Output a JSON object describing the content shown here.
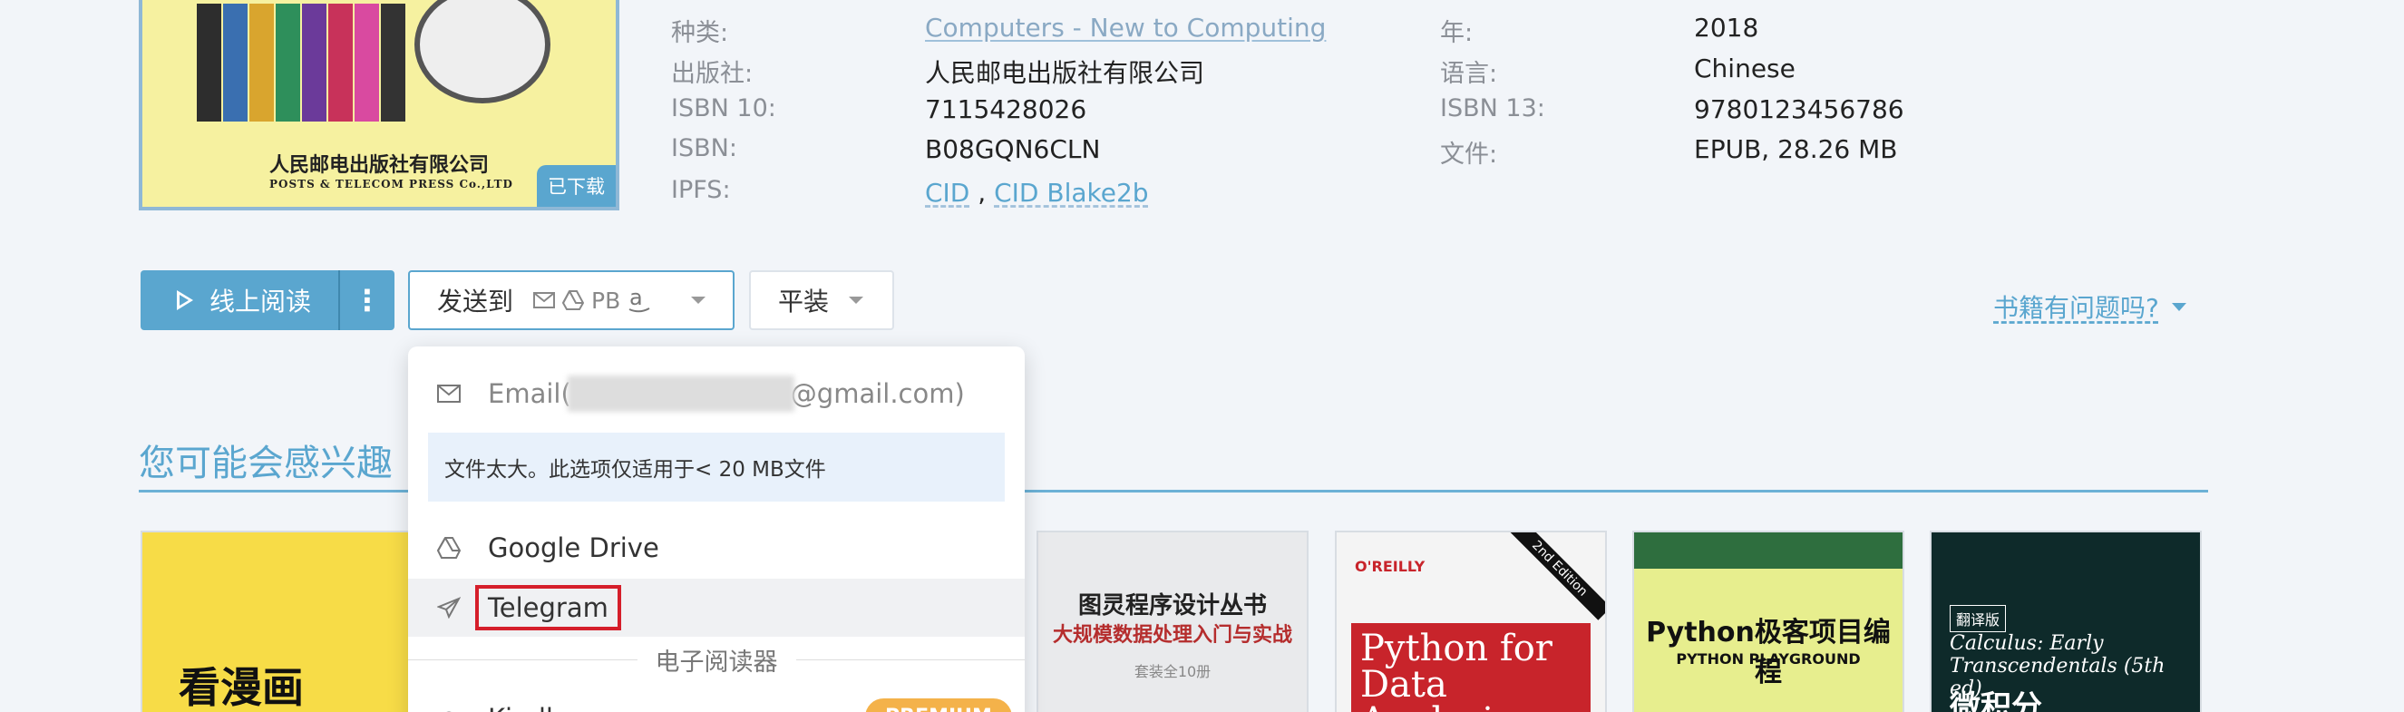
{
  "cover": {
    "publisher_cn": "人民邮电出版社有限公司",
    "publisher_en": "POSTS & TELECOM PRESS Co.,LTD",
    "badge": "已下载"
  },
  "meta": {
    "category_label": "种类:",
    "category_value": "Computers - New to Computing",
    "publisher_label": "出版社:",
    "publisher_value": "人民邮电出版社有限公司",
    "isbn10_label": "ISBN 10:",
    "isbn10_value": "7115428026",
    "isbn_label": "ISBN:",
    "isbn_value": "B08GQN6CLN",
    "ipfs_label": "IPFS:",
    "ipfs_cid": "CID",
    "ipfs_sep": ",",
    "ipfs_blake": "CID Blake2b",
    "year_label": "年:",
    "year_value": "2018",
    "language_label": "语言:",
    "language_value": "Chinese",
    "isbn13_label": "ISBN 13:",
    "isbn13_value": "9780123456786",
    "file_label": "文件:",
    "file_value": "EPUB, 28.26 MB"
  },
  "actions": {
    "read_online": "线上阅读",
    "more": "⋮",
    "send_to": "发送到",
    "send_pb": "PB",
    "format": "平装",
    "report": "书籍有问题吗?"
  },
  "recommend": {
    "title": "您可能会感兴趣",
    "books": [
      {
        "title": "看漫画"
      },
      {
        "series": "图灵程序设计丛书",
        "title": "大规模数据处理入门与实战",
        "note": "套装全10册"
      },
      {
        "publisher": "O'REILLY",
        "edition": "2nd Edition",
        "title": "Python for Data Analysis"
      },
      {
        "title": "Python极客项目编程",
        "subtitle": "PYTHON PLAYGROUND"
      },
      {
        "badge": "翻译版",
        "title": "Calculus: Early Transcendentals (5th ed)",
        "cn_title": "微积分"
      }
    ]
  },
  "dropdown": {
    "email_prefix": "Email(",
    "email_suffix": "@gmail.com)",
    "warning": "文件太大。此选项仅适用于< 20 MB文件",
    "gdrive": "Google Drive",
    "telegram": "Telegram",
    "ereader_divider": "电子阅读器",
    "kindle": "Kindle",
    "premium": "PREMIUM"
  },
  "colors": {
    "accent": "#5aa6cf",
    "highlight_border": "#d51e2a",
    "premium": "#f4b24a"
  }
}
